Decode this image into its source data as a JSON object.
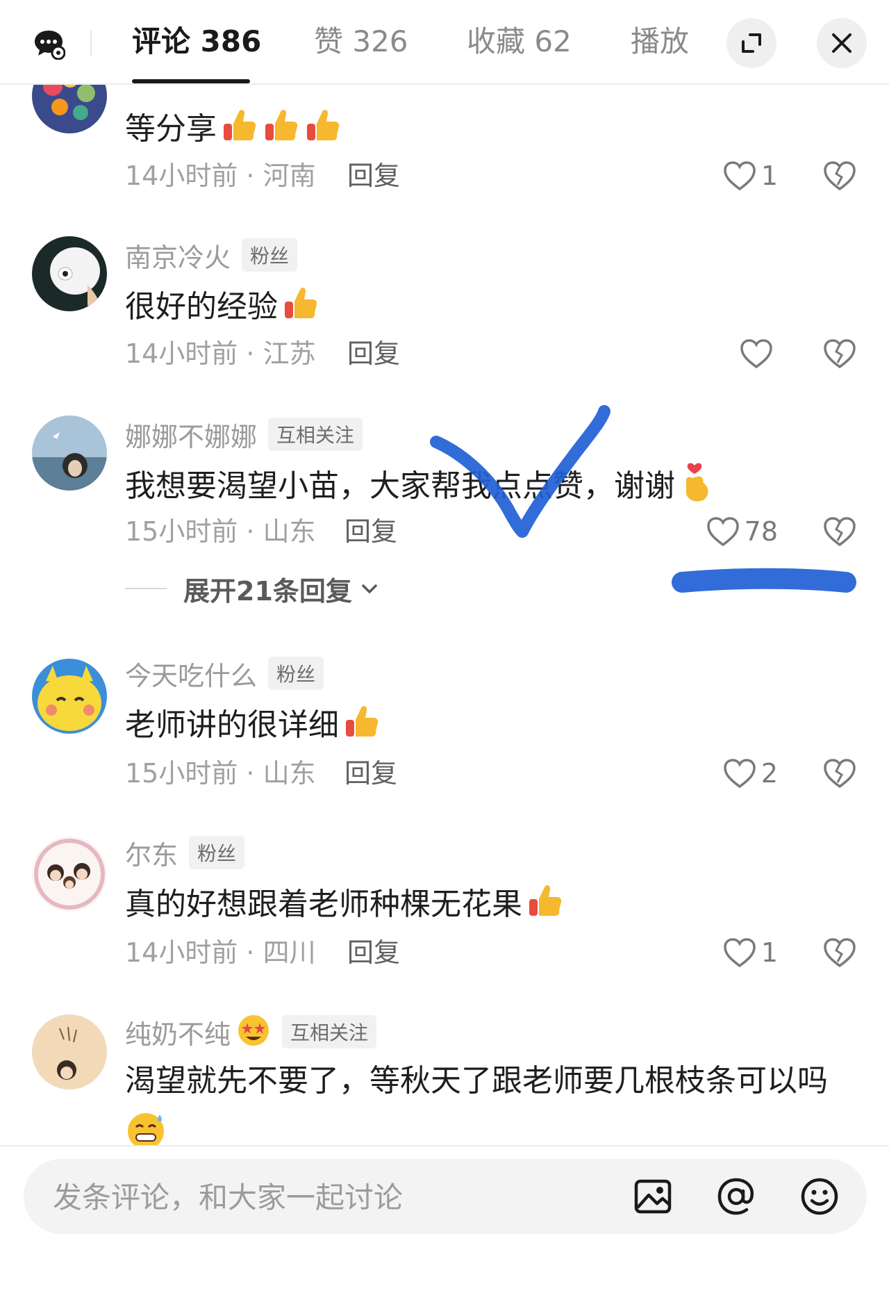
{
  "tabs": [
    {
      "label": "评论 386",
      "active": true
    },
    {
      "label": "赞 326",
      "active": false
    },
    {
      "label": "收藏 62",
      "active": false
    },
    {
      "label": "播放",
      "active": false
    }
  ],
  "comments": [
    {
      "username": "",
      "text": "等分享",
      "time_location": "14小时前 · 河南",
      "reply_label": "回复",
      "likes": "1",
      "emoji": [
        "thumbs-up-emoji",
        "thumbs-up-emoji",
        "thumbs-up-emoji"
      ]
    },
    {
      "username": "南京冷火",
      "tag": "粉丝",
      "text": "很好的经验",
      "time_location": "14小时前 · 江苏",
      "reply_label": "回复",
      "likes": "",
      "emoji": [
        "thumbs-up-emoji"
      ]
    },
    {
      "username": "娜娜不娜娜",
      "tag": "互相关注",
      "text": "我想要渴望小苗，大家帮我点点赞，谢谢",
      "time_location": "15小时前 · 山东",
      "reply_label": "回复",
      "likes": "78",
      "expand_label": "展开21条回复",
      "emoji": [
        "finger-heart-emoji"
      ]
    },
    {
      "username": "今天吃什么",
      "tag": "粉丝",
      "text": "老师讲的很详细",
      "time_location": "15小时前 · 山东",
      "reply_label": "回复",
      "likes": "2",
      "emoji": [
        "thumbs-up-emoji"
      ]
    },
    {
      "username": "尔东",
      "tag": "粉丝",
      "text": "真的好想跟着老师种棵无花果",
      "time_location": "14小时前 · 四川",
      "reply_label": "回复",
      "likes": "1",
      "emoji": [
        "thumbs-up-emoji"
      ]
    },
    {
      "username": "纯奶不纯",
      "tag": "互相关注",
      "text": "渴望就先不要了，等秋天了跟老师要几根枝条可以吗",
      "emoji": [
        "star-struck-emoji",
        "sweat-grin-emoji"
      ]
    }
  ],
  "input": {
    "placeholder": "发条评论，和大家一起讨论"
  },
  "colors": {
    "annotation_blue": "#1f5fd6",
    "like_heart": "#7a7a7a"
  }
}
